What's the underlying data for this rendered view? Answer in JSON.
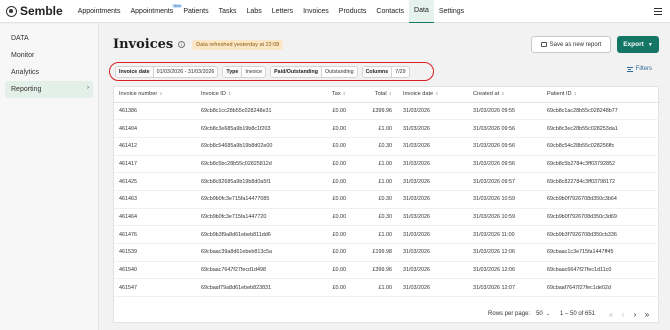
{
  "app": {
    "logo_text": "Semble"
  },
  "topnav": {
    "items": [
      {
        "label": "Appointments"
      },
      {
        "label": "Appointments",
        "badge": "New"
      },
      {
        "label": "Patients"
      },
      {
        "label": "Tasks"
      },
      {
        "label": "Labs"
      },
      {
        "label": "Letters"
      },
      {
        "label": "Invoices"
      },
      {
        "label": "Products"
      },
      {
        "label": "Contacts"
      },
      {
        "label": "Data",
        "active": true
      },
      {
        "label": "Settings"
      }
    ],
    "menu_icon": "hamburger-icon"
  },
  "sidebar": {
    "heading": "DATA",
    "items": [
      {
        "label": "Monitor"
      },
      {
        "label": "Analytics"
      },
      {
        "label": "Reporting",
        "active": true
      }
    ]
  },
  "page": {
    "title": "Invoices",
    "refresh_badge": "Data refreshed yesterday at 22:08",
    "save_label": "Save as new report",
    "export_label": "Export",
    "filters_label": "Filters"
  },
  "filters": [
    {
      "key": "Invoice date",
      "value": "01/03/2026 - 31/03/2026"
    },
    {
      "key": "Type",
      "value": "Invoice"
    },
    {
      "key": "Paid/Outstanding",
      "value": "Outstanding"
    },
    {
      "key": "Columns",
      "value": "7/29"
    }
  ],
  "table": {
    "columns": [
      "Invoice number",
      "Invoice ID",
      "Tax",
      "Total",
      "Invoice date",
      "Created at",
      "Patient ID"
    ],
    "rows": [
      [
        "461386",
        "69cb8c1cc28b55c028248e31",
        "£0.00",
        "£399.96",
        "31/03/2026",
        "31/03/2026 09:55",
        "69cb8c1ac28b55c028248b77"
      ],
      [
        "461404",
        "69cb8c3e685a9b19b8c1f203",
        "£0.00",
        "£1.00",
        "31/03/2026",
        "31/03/2026 09:56",
        "69cb8c3ec28b55c028253da1"
      ],
      [
        "461412",
        "69cb8c54685a9b19b8d02e00",
        "£0.00",
        "£0.30",
        "31/03/2026",
        "31/03/2026 09:56",
        "69cb8c54c28b55c028256ffc"
      ],
      [
        "461417",
        "69cb8c5bc28b55c02825812d",
        "£0.00",
        "£1.00",
        "31/03/2026",
        "31/03/2026 09:56",
        "69cb8c5b2784c3ff03792852"
      ],
      [
        "461425",
        "69cb8c82685a9b19b8d0a5f1",
        "£0.00",
        "£1.00",
        "31/03/2026",
        "31/03/2026 09:57",
        "69cb8c822784c3ff03798172"
      ],
      [
        "461463",
        "69cb9b0fc3e715fa14477085",
        "£0.00",
        "£0.30",
        "31/03/2026",
        "31/03/2026 10:59",
        "69cb9b0f7926708d350c3b64"
      ],
      [
        "461464",
        "69cb9b0fc3e715fa1447720",
        "£0.00",
        "£0.30",
        "31/03/2026",
        "31/03/2026 10:59",
        "69cb9b0f7926708d350c3d69"
      ],
      [
        "461476",
        "69cb9b3f9a8d61ebeb811dd6",
        "£0.00",
        "£1.00",
        "31/03/2026",
        "31/03/2026 11:00",
        "69cb9b3f7926708d350cb336"
      ],
      [
        "461539",
        "69cbaac39a8d61ebeb813c5a",
        "£0.00",
        "£199.98",
        "31/03/2026",
        "31/03/2026 12:06",
        "69cbaac1c3e715fa1447ff45"
      ],
      [
        "461540",
        "69cbaac7647f27fecd1d498",
        "£0.00",
        "£399.96",
        "31/03/2026",
        "31/03/2026 12:06",
        "69cbaac6647f27fec1d11c0"
      ],
      [
        "461547",
        "69cbaaf79a8d61ebeb823831",
        "£0.00",
        "£1.00",
        "31/03/2026",
        "31/03/2026 12:07",
        "69cbaaf7647f27fec1de02d"
      ]
    ]
  },
  "pagination": {
    "rows_per_page_label": "Rows per page:",
    "rows_per_page": "50",
    "range": "1 – 50 of 651"
  }
}
